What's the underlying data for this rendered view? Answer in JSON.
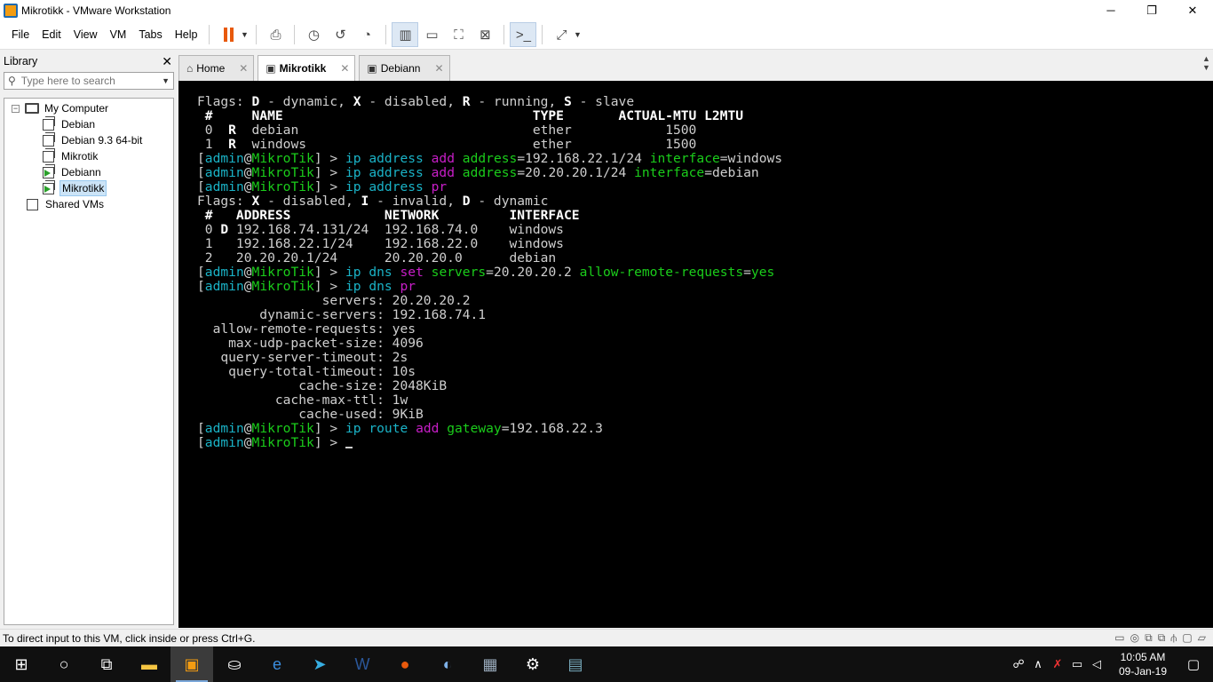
{
  "window": {
    "title": "Mikrotikk - VMware Workstation",
    "minimize": "─",
    "maximize": "❐",
    "close": "✕"
  },
  "menu": {
    "file": "File",
    "edit": "Edit",
    "view": "View",
    "vm": "VM",
    "tabs": "Tabs",
    "help": "Help"
  },
  "library": {
    "title": "Library",
    "close": "✕",
    "search_placeholder": "Type here to search",
    "tree": {
      "root": "My Computer",
      "items": [
        "Debian",
        "Debian 9.3 64-bit",
        "Mikrotik",
        "Debiann",
        "Mikrotikk"
      ],
      "shared": "Shared VMs"
    }
  },
  "tabs": [
    {
      "label": "Home",
      "close": "✕"
    },
    {
      "label": "Mikrotikk",
      "close": "✕"
    },
    {
      "label": "Debiann",
      "close": "✕"
    }
  ],
  "console": {
    "lines": [
      [
        [
          "w",
          "Flags: "
        ],
        [
          "b",
          "D"
        ],
        [
          "w",
          " - dynamic, "
        ],
        [
          "b",
          "X"
        ],
        [
          "w",
          " - disabled, "
        ],
        [
          "b",
          "R"
        ],
        [
          "w",
          " - running, "
        ],
        [
          "b",
          "S"
        ],
        [
          "w",
          " - slave"
        ]
      ],
      [
        [
          "b",
          " #     NAME                                TYPE       ACTUAL-MTU L2MTU"
        ]
      ],
      [
        [
          "w",
          " 0  "
        ],
        [
          "b",
          "R"
        ],
        [
          "w",
          "  debian                              ether            1500"
        ]
      ],
      [
        [
          "w",
          " 1  "
        ],
        [
          "b",
          "R"
        ],
        [
          "w",
          "  windows                             ether            1500"
        ]
      ],
      [
        [
          "w",
          "["
        ],
        [
          "c",
          "admin"
        ],
        [
          "w",
          "@"
        ],
        [
          "g",
          "MikroTik"
        ],
        [
          "w",
          "] > "
        ],
        [
          "c",
          "ip address "
        ],
        [
          "m",
          "add "
        ],
        [
          "g",
          "address"
        ],
        [
          "w",
          "=192.168.22.1/24 "
        ],
        [
          "g",
          "interface"
        ],
        [
          "w",
          "=windows"
        ]
      ],
      [
        [
          "w",
          "["
        ],
        [
          "c",
          "admin"
        ],
        [
          "w",
          "@"
        ],
        [
          "g",
          "MikroTik"
        ],
        [
          "w",
          "] > "
        ],
        [
          "c",
          "ip address "
        ],
        [
          "m",
          "add "
        ],
        [
          "g",
          "address"
        ],
        [
          "w",
          "=20.20.20.1/24 "
        ],
        [
          "g",
          "interface"
        ],
        [
          "w",
          "=debian"
        ]
      ],
      [
        [
          "w",
          "["
        ],
        [
          "c",
          "admin"
        ],
        [
          "w",
          "@"
        ],
        [
          "g",
          "MikroTik"
        ],
        [
          "w",
          "] > "
        ],
        [
          "c",
          "ip address "
        ],
        [
          "m",
          "pr"
        ]
      ],
      [
        [
          "w",
          "Flags: "
        ],
        [
          "b",
          "X"
        ],
        [
          "w",
          " - disabled, "
        ],
        [
          "b",
          "I"
        ],
        [
          "w",
          " - invalid, "
        ],
        [
          "b",
          "D"
        ],
        [
          "w",
          " - dynamic"
        ]
      ],
      [
        [
          "b",
          " #   ADDRESS            NETWORK         INTERFACE"
        ]
      ],
      [
        [
          "w",
          " 0 "
        ],
        [
          "b",
          "D"
        ],
        [
          "w",
          " 192.168.74.131/24  192.168.74.0    windows"
        ]
      ],
      [
        [
          "w",
          " 1   192.168.22.1/24    192.168.22.0    windows"
        ]
      ],
      [
        [
          "w",
          " 2   20.20.20.1/24      20.20.20.0      debian"
        ]
      ],
      [
        [
          "w",
          "["
        ],
        [
          "c",
          "admin"
        ],
        [
          "w",
          "@"
        ],
        [
          "g",
          "MikroTik"
        ],
        [
          "w",
          "] > "
        ],
        [
          "c",
          "ip dns "
        ],
        [
          "m",
          "set "
        ],
        [
          "g",
          "servers"
        ],
        [
          "w",
          "=20.20.20.2 "
        ],
        [
          "g",
          "allow-remote-requests"
        ],
        [
          "w",
          "="
        ],
        [
          "g",
          "yes"
        ]
      ],
      [
        [
          "w",
          "["
        ],
        [
          "c",
          "admin"
        ],
        [
          "w",
          "@"
        ],
        [
          "g",
          "MikroTik"
        ],
        [
          "w",
          "] > "
        ],
        [
          "c",
          "ip dns "
        ],
        [
          "m",
          "pr"
        ]
      ],
      [
        [
          "w",
          "                servers: 20.20.20.2"
        ]
      ],
      [
        [
          "w",
          "        dynamic-servers: 192.168.74.1"
        ]
      ],
      [
        [
          "w",
          "  allow-remote-requests: yes"
        ]
      ],
      [
        [
          "w",
          "    max-udp-packet-size: 4096"
        ]
      ],
      [
        [
          "w",
          "   query-server-timeout: 2s"
        ]
      ],
      [
        [
          "w",
          "    query-total-timeout: 10s"
        ]
      ],
      [
        [
          "w",
          "             cache-size: 2048KiB"
        ]
      ],
      [
        [
          "w",
          "          cache-max-ttl: 1w"
        ]
      ],
      [
        [
          "w",
          "             cache-used: 9KiB"
        ]
      ],
      [
        [
          "w",
          "["
        ],
        [
          "c",
          "admin"
        ],
        [
          "w",
          "@"
        ],
        [
          "g",
          "MikroTik"
        ],
        [
          "w",
          "] > "
        ],
        [
          "c",
          "ip route "
        ],
        [
          "m",
          "add "
        ],
        [
          "g",
          "gateway"
        ],
        [
          "w",
          "=192.168.22.3"
        ]
      ],
      [
        [
          "w",
          "["
        ],
        [
          "c",
          "admin"
        ],
        [
          "w",
          "@"
        ],
        [
          "g",
          "MikroTik"
        ],
        [
          "w",
          "] > "
        ]
      ]
    ]
  },
  "status": {
    "text": "To direct input to this VM, click inside or press Ctrl+G."
  },
  "taskbar": {
    "time": "10:05 AM",
    "date": "09-Jan-19"
  },
  "colors": {
    "term_cyan": "#1ab3c7",
    "term_green": "#1bcd1b",
    "term_magenta": "#c81ec8",
    "console_bg": "#000000"
  }
}
